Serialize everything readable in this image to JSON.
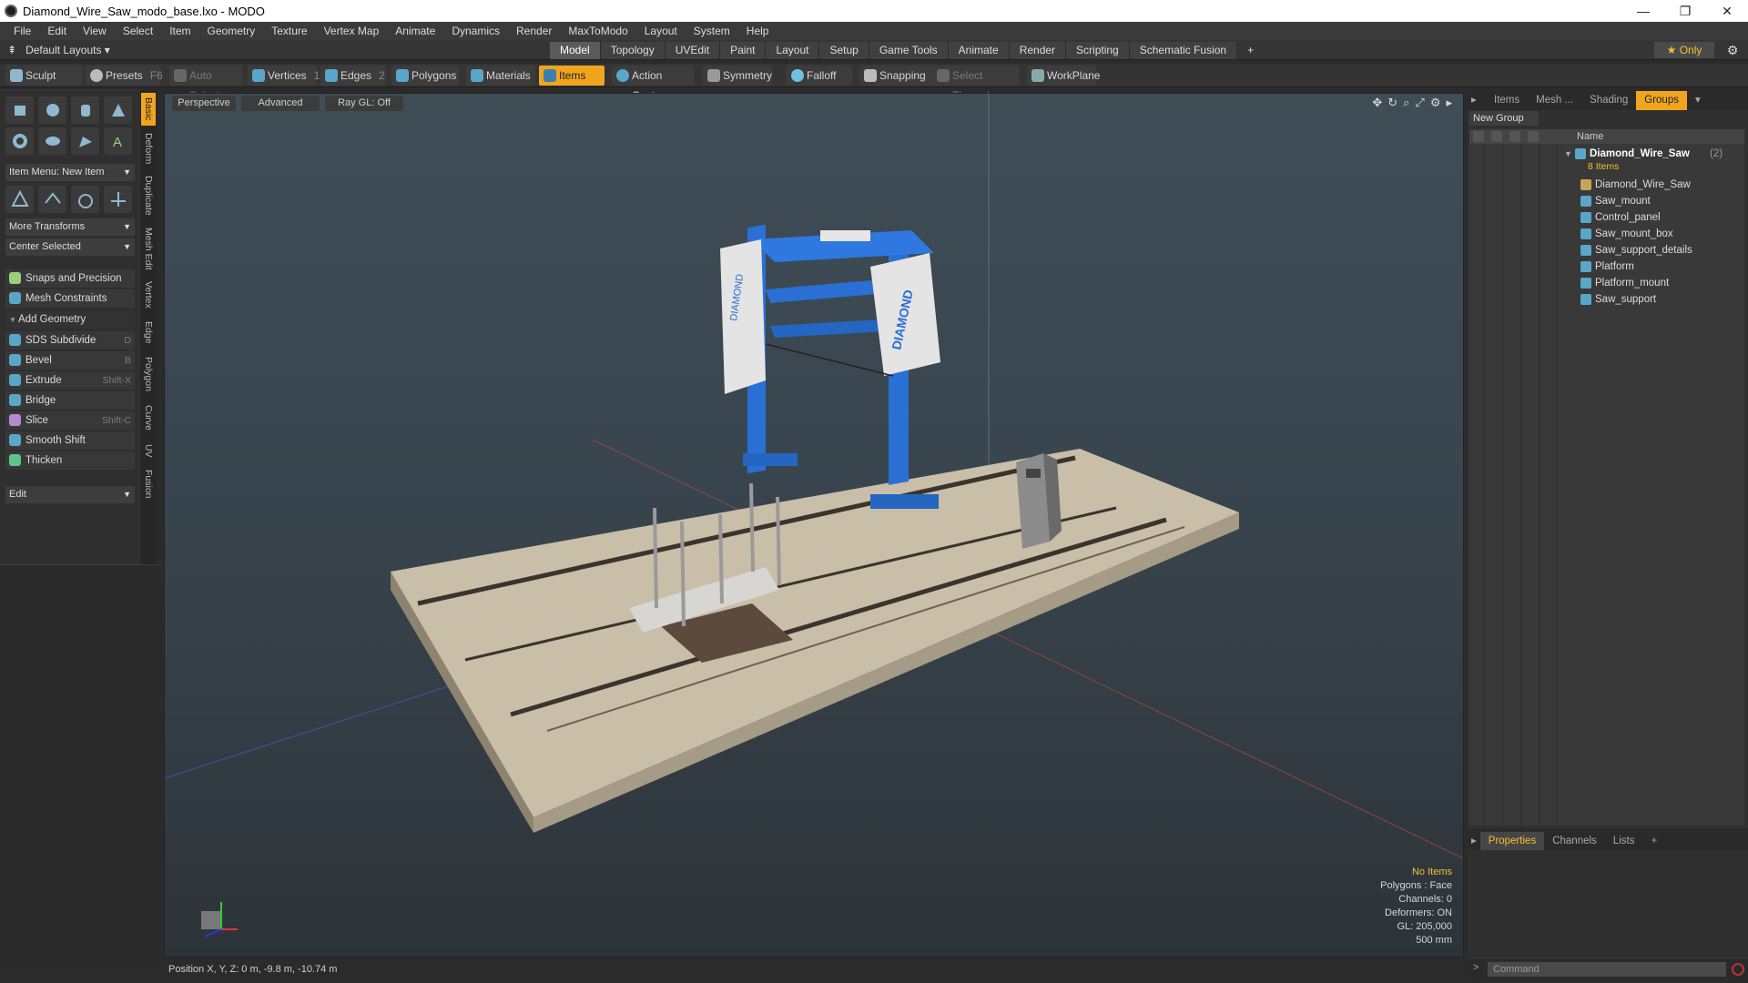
{
  "window": {
    "title": "Diamond_Wire_Saw_modo_base.lxo - MODO",
    "controls": [
      "—",
      "❐",
      "✕"
    ]
  },
  "menu": [
    "File",
    "Edit",
    "View",
    "Select",
    "Item",
    "Geometry",
    "Texture",
    "Vertex Map",
    "Animate",
    "Dynamics",
    "Render",
    "MaxToModo",
    "Layout",
    "System",
    "Help"
  ],
  "layoutbar": {
    "layout_select": "Default Layouts ▾",
    "tabs": [
      "Model",
      "Topology",
      "UVEdit",
      "Paint",
      "Layout",
      "Setup",
      "Game Tools",
      "Animate",
      "Render",
      "Scripting",
      "Schematic Fusion"
    ],
    "active_tab": "Model",
    "add_tab": "+",
    "only_label": "★  Only",
    "gear": "⚙"
  },
  "toolbar": {
    "sculpt": "Sculpt",
    "presets": "Presets",
    "presets_shortcut": "F6",
    "auto_select": "Auto Select",
    "vertices": "Vertices",
    "vertices_count": "1",
    "edges": "Edges",
    "edges_count": "2",
    "polygons": "Polygons",
    "materials": "Materials",
    "items": "Items",
    "action_center": "Action Center",
    "symmetry": "Symmetry",
    "falloff": "Falloff",
    "snapping": "Snapping",
    "select_through": "Select Through",
    "workplane": "WorkPlane"
  },
  "toolpanel": {
    "item_menu": "Item Menu: New Item",
    "more_transforms": "More Transforms",
    "center_selected": "Center Selected",
    "snaps": "Snaps and Precision",
    "mesh_constraints": "Mesh Constraints",
    "add_geometry": "Add Geometry",
    "tools": [
      {
        "label": "SDS Subdivide",
        "shortcut": "D"
      },
      {
        "label": "Bevel",
        "shortcut": "B"
      },
      {
        "label": "Extrude",
        "shortcut": "Shift-X"
      },
      {
        "label": "Bridge",
        "shortcut": ""
      },
      {
        "label": "Slice",
        "shortcut": "Shift-C"
      },
      {
        "label": "Smooth Shift",
        "shortcut": ""
      },
      {
        "label": "Thicken",
        "shortcut": ""
      }
    ],
    "edit": "Edit"
  },
  "sidetabs": [
    "Basic",
    "Deform",
    "Duplicate",
    "Mesh Edit",
    "Vertex",
    "Edge",
    "Polygon",
    "Curve",
    "UV",
    "Fusion"
  ],
  "viewport": {
    "perspective": "Perspective",
    "advanced": "Advanced",
    "raygl": "Ray GL: Off",
    "info": {
      "no_items": "No Items",
      "polygons": "Polygons : Face",
      "channels": "Channels: 0",
      "deformers": "Deformers: ON",
      "gl": "GL: 205,000",
      "scale": "500 mm"
    },
    "saw_text": "DIAMOND"
  },
  "status": {
    "position": "Position X, Y, Z:  0 m, -9.8 m, -10.74 m"
  },
  "rightpanel": {
    "tabs": [
      "Items",
      "Mesh ...",
      "Shading",
      "Groups"
    ],
    "active_tab": "Groups",
    "new_group": "New Group",
    "name_col": "Name",
    "group": {
      "name": "Diamond_Wire_Saw",
      "count": "(2)",
      "sub": "8 Items"
    },
    "items": [
      "Diamond_Wire_Saw",
      "Saw_mount",
      "Control_panel",
      "Saw_mount_box",
      "Saw_support_details",
      "Platform",
      "Platform_mount",
      "Saw_support"
    ]
  },
  "props": {
    "tabs": [
      "Properties",
      "Channels",
      "Lists",
      "+"
    ],
    "active_tab": "Properties"
  },
  "command": {
    "prompt": ">",
    "placeholder": "Command"
  },
  "colors": {
    "accent": "#f1a51e",
    "saw_blue": "#2a6fd3",
    "platform": "#cbbfa8"
  }
}
